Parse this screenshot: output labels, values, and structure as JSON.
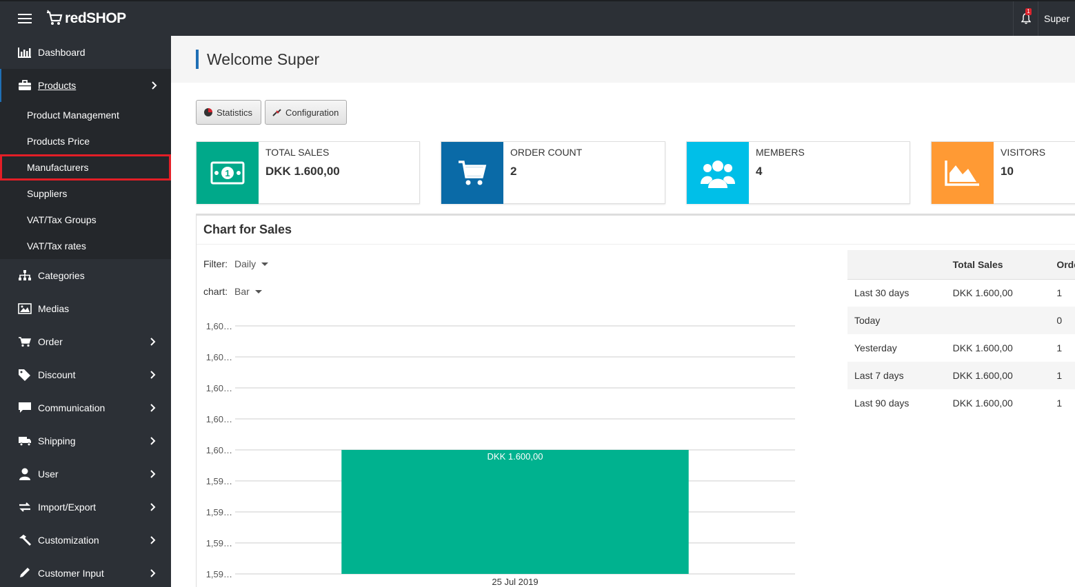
{
  "topbar": {
    "logo_text": "redSHOP",
    "notification_count": "1",
    "user_name": "Super"
  },
  "sidebar": {
    "items": [
      {
        "label": "Dashboard",
        "icon": "bar-chart-icon"
      },
      {
        "label": "Products",
        "icon": "briefcase-icon",
        "active": true,
        "submenu": [
          "Product Management",
          "Products Price",
          "Manufacturers",
          "Suppliers",
          "VAT/Tax Groups",
          "VAT/Tax rates"
        ]
      },
      {
        "label": "Categories",
        "icon": "sitemap-icon"
      },
      {
        "label": "Medias",
        "icon": "image-icon"
      },
      {
        "label": "Order",
        "icon": "cart-icon"
      },
      {
        "label": "Discount",
        "icon": "tag-icon"
      },
      {
        "label": "Communication",
        "icon": "comment-icon"
      },
      {
        "label": "Shipping",
        "icon": "truck-icon"
      },
      {
        "label": "User",
        "icon": "user-icon"
      },
      {
        "label": "Import/Export",
        "icon": "exchange-icon"
      },
      {
        "label": "Customization",
        "icon": "hammer-icon"
      },
      {
        "label": "Customer Input",
        "icon": "pencil-icon"
      }
    ]
  },
  "page": {
    "title": "Welcome Super",
    "buttons": {
      "statistics": "Statistics",
      "configuration": "Configuration"
    }
  },
  "cards": [
    {
      "label": "TOTAL SALES",
      "value": "DKK 1.600,00",
      "color": "#00a98a",
      "icon": "money-icon"
    },
    {
      "label": "ORDER COUNT",
      "value": "2",
      "color": "#0a6aa7",
      "icon": "cart-icon"
    },
    {
      "label": "MEMBERS",
      "value": "4",
      "color": "#00bfe8",
      "icon": "users-icon"
    },
    {
      "label": "VISITORS",
      "value": "10",
      "color": "#ff9a34",
      "icon": "area-chart-icon"
    }
  ],
  "chart_panel": {
    "title": "Chart for Sales",
    "filter_label": "Filter:",
    "filter_value": "Daily",
    "chart_label": "chart:",
    "chart_value": "Bar"
  },
  "stats_table": {
    "headers": [
      "",
      "Total Sales",
      "Orde"
    ],
    "rows": [
      [
        "Last 30 days",
        "DKK 1.600,00",
        "1"
      ],
      [
        "Today",
        "",
        "0"
      ],
      [
        "Yesterday",
        "DKK 1.600,00",
        "1"
      ],
      [
        "Last 7 days",
        "DKK 1.600,00",
        "1"
      ],
      [
        "Last 90 days",
        "DKK 1.600,00",
        "1"
      ]
    ]
  },
  "chart_data": {
    "type": "bar",
    "categories": [
      "25 Jul 2019"
    ],
    "values": [
      1600
    ],
    "data_labels": [
      "DKK 1.600,00"
    ],
    "y_tick_labels": [
      "1,60…",
      "1,60…",
      "1,60…",
      "1,60…",
      "1,60…",
      "1,59…",
      "1,59…",
      "1,59…",
      "1,59…"
    ],
    "ylim": [
      1599.8,
      1600.2
    ],
    "bar_color": "#00b28f",
    "grid": true
  }
}
